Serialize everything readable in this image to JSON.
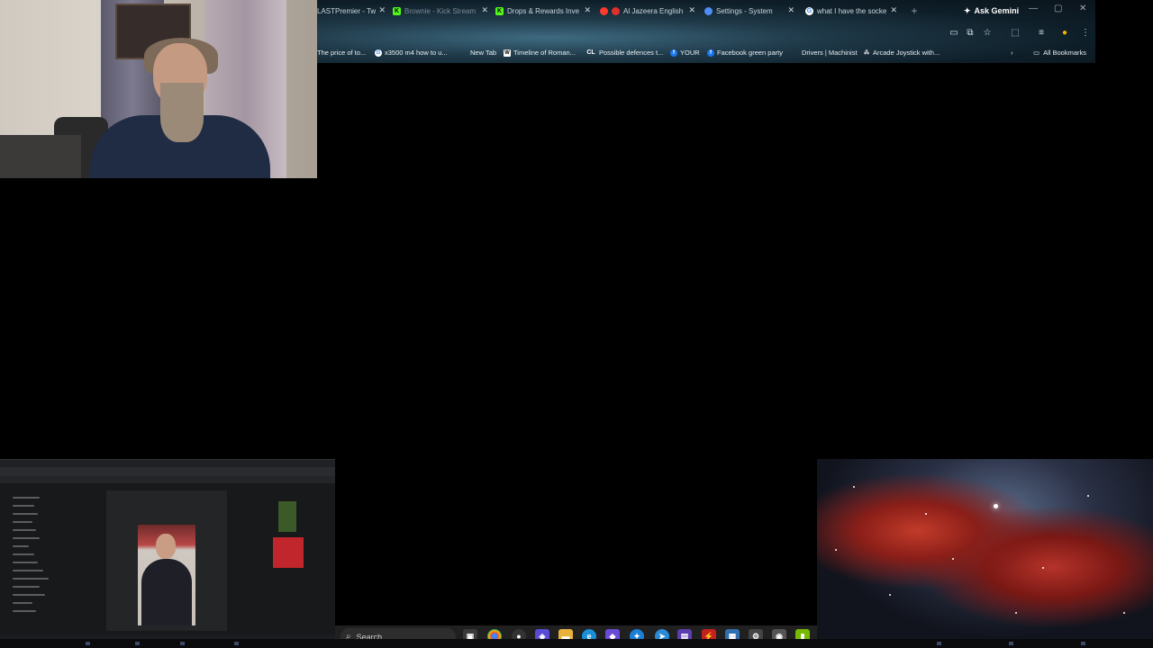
{
  "browser": {
    "tabs": [
      {
        "label": "LASTPremier - Tw",
        "color": "#8c6bd6"
      },
      {
        "label": "Brownie - Kick Stream",
        "color": "#53fc18",
        "glyph": "K"
      },
      {
        "label": "Drops & Rewards Inve",
        "color": "#53fc18",
        "glyph": "K"
      },
      {
        "label": "Al Jazeera English",
        "color": "#ff3b30"
      },
      {
        "label": "Settings - System",
        "color": "#4f8ef7"
      },
      {
        "label": "what I have the socke",
        "color": "#ffffff",
        "glyph": "G"
      }
    ],
    "ask_gemini": "Ask Gemini",
    "new_tab": "+",
    "bookmarks": [
      {
        "label": "The price of to...",
        "glyph": ""
      },
      {
        "label": "x3500 m4 how to u...",
        "glyph": "G"
      },
      {
        "label": "New Tab",
        "glyph": ""
      },
      {
        "label": "Timeline of Roman...",
        "glyph": "W"
      },
      {
        "label": "Possible defences t...",
        "glyph": "CL"
      },
      {
        "label": "YOUR",
        "glyph": "f"
      },
      {
        "label": "Facebook green party",
        "glyph": "f"
      },
      {
        "label": "Drivers | Machinist",
        "glyph": ""
      },
      {
        "label": "Arcade Joystick with...",
        "glyph": "⁂"
      }
    ],
    "all_bookmarks": "All Bookmarks"
  },
  "taskbar": {
    "search_placeholder": "Search"
  }
}
